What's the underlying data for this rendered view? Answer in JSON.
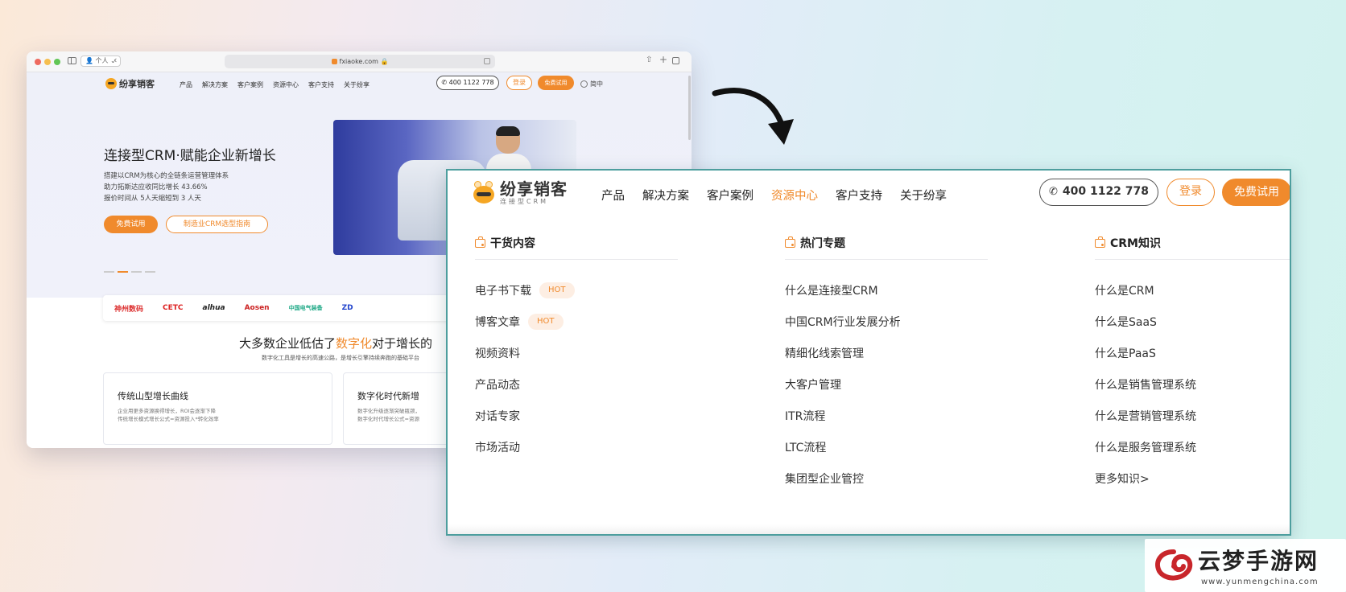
{
  "browser": {
    "profile_label": "个人",
    "url": "fxiaoke.com",
    "page": {
      "brand": "纷享销客",
      "nav": [
        "产品",
        "解决方案",
        "客户案例",
        "资源中心",
        "客户支持",
        "关于纷享"
      ],
      "phone": "400 1122 778",
      "login": "登录",
      "trial": "免费试用",
      "lang": "简中",
      "hero_title": "连接型CRM·赋能企业新增长",
      "hero_lines": [
        "搭建以CRM为核心的全链条运营管理体系",
        "助力拓斯达应收同比增长 43.66%",
        "报价时间从 5人天缩短到 3 人天"
      ],
      "hero_btn_primary": "免费试用",
      "hero_btn_secondary": "制造业CRM选型指南",
      "partner_logos": [
        "神州数码",
        "CETC",
        "alhua",
        "Aosen",
        "中国电气装备",
        "ZD"
      ],
      "section_title_pre": "大多数企业低估了",
      "section_title_highlight": "数字化",
      "section_title_post": "对于增长的",
      "section_sub": "数字化工具是增长的高速公路，是增长引擎持续奔跑的基础平台",
      "cards": [
        {
          "title": "传统山型增长曲线",
          "lines": [
            "企业用更多资源换得增长，ROI会逐渐下降",
            "传统增长模式增长公式=资源投入*转化效率"
          ]
        },
        {
          "title": "数字化时代新增",
          "lines": [
            "数字化升级逐渐突破瓶颈，",
            "数字化时代增长公式=资源"
          ]
        }
      ]
    }
  },
  "zoom": {
    "brand": "纷享销客",
    "brand_tag": "连接型CRM",
    "nav": [
      {
        "label": "产品",
        "active": false
      },
      {
        "label": "解决方案",
        "active": false
      },
      {
        "label": "客户案例",
        "active": false
      },
      {
        "label": "资源中心",
        "active": true
      },
      {
        "label": "客户支持",
        "active": false
      },
      {
        "label": "关于纷享",
        "active": false
      }
    ],
    "phone": "400 1122 778",
    "login": "登录",
    "trial": "免费试用",
    "columns": [
      {
        "title": "干货内容",
        "items": [
          {
            "label": "电子书下载",
            "badge": "HOT"
          },
          {
            "label": "博客文章",
            "badge": "HOT"
          },
          {
            "label": "视频资料"
          },
          {
            "label": "产品动态"
          },
          {
            "label": "对话专家"
          },
          {
            "label": "市场活动"
          }
        ]
      },
      {
        "title": "热门专题",
        "items": [
          {
            "label": "什么是连接型CRM"
          },
          {
            "label": "中国CRM行业发展分析"
          },
          {
            "label": "精细化线索管理"
          },
          {
            "label": "大客户管理"
          },
          {
            "label": "ITR流程"
          },
          {
            "label": "LTC流程"
          },
          {
            "label": "集团型企业管控"
          }
        ]
      },
      {
        "title": "CRM知识",
        "items": [
          {
            "label": "什么是CRM"
          },
          {
            "label": "什么是SaaS"
          },
          {
            "label": "什么是PaaS"
          },
          {
            "label": "什么是销售管理系统"
          },
          {
            "label": "什么是营销管理系统"
          },
          {
            "label": "什么是服务管理系统"
          },
          {
            "label": "更多知识>"
          }
        ]
      }
    ]
  },
  "watermark": {
    "text": "云梦手游网",
    "url": "www.yunmengchina.com"
  },
  "colors": {
    "accent": "#f08a2c",
    "panel_border": "#4d9e9e",
    "hot_badge_bg": "#fdeee3"
  },
  "icons": {
    "phone": "phone-icon",
    "column": "briefcase-icon",
    "arrow": "curved-arrow-icon",
    "globe": "globe-icon"
  }
}
